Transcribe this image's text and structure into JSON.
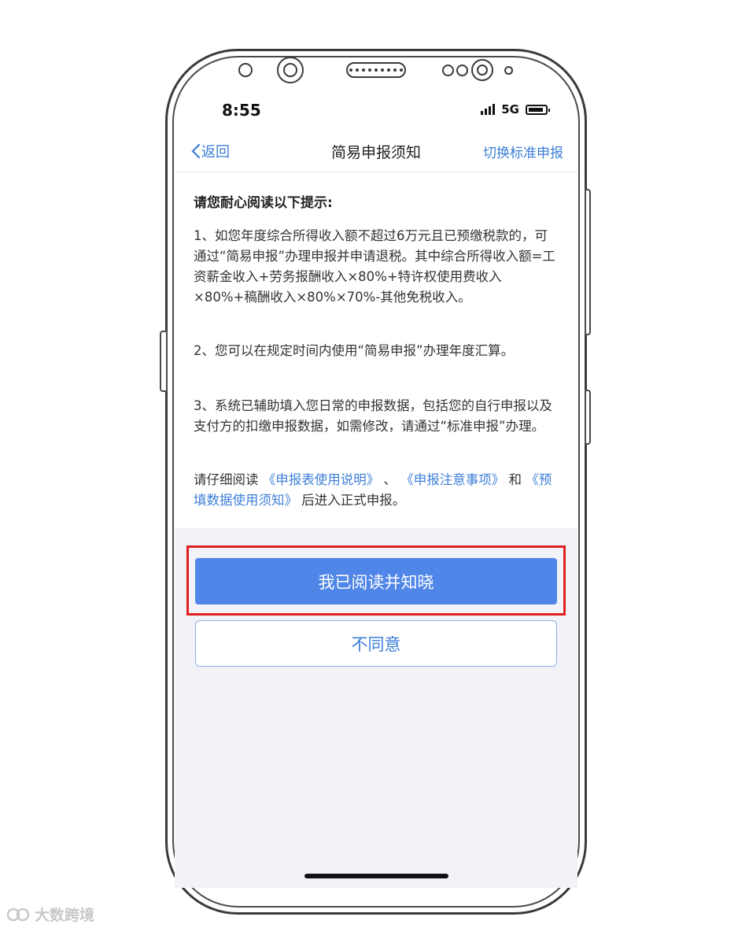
{
  "status_bar": {
    "time": "8:55",
    "network": "5G"
  },
  "nav": {
    "back_label": "返回",
    "title": "简易申报须知",
    "switch_label": "切换标准申报"
  },
  "content": {
    "heading": "请您耐心阅读以下提示:",
    "item1": "1、如您年度综合所得收入额不超过6万元且已预缴税款的，可通过“简易申报”办理申报并申请退税。其中综合所得收入额=工资薪金收入+劳务报酬收入×80%+特许权使用费收入×80%+稿酬收入×80%×70%-其他免税收入。",
    "item2": "2、您可以在规定时间内使用“简易申报”办理年度汇算。",
    "item3": "3、系统已辅助填入您日常的申报数据，包括您的自行申报以及支付方的扣缴申报数据，如需修改，请通过“标准申报”办理。",
    "notice_prefix": "请仔细阅读",
    "link1": "《申报表使用说明》",
    "sep1": "、",
    "link2": "《申报注意事项》",
    "sep2": "和",
    "link3": "《预填数据使用须知》",
    "notice_suffix": "后进入正式申报。"
  },
  "buttons": {
    "agree": "我已阅读并知晓",
    "disagree": "不同意"
  },
  "colors": {
    "accent": "#4f86e8",
    "link": "#3e7fd8",
    "highlight": "#e21e1e"
  },
  "watermark": {
    "text": "大数跨境"
  }
}
